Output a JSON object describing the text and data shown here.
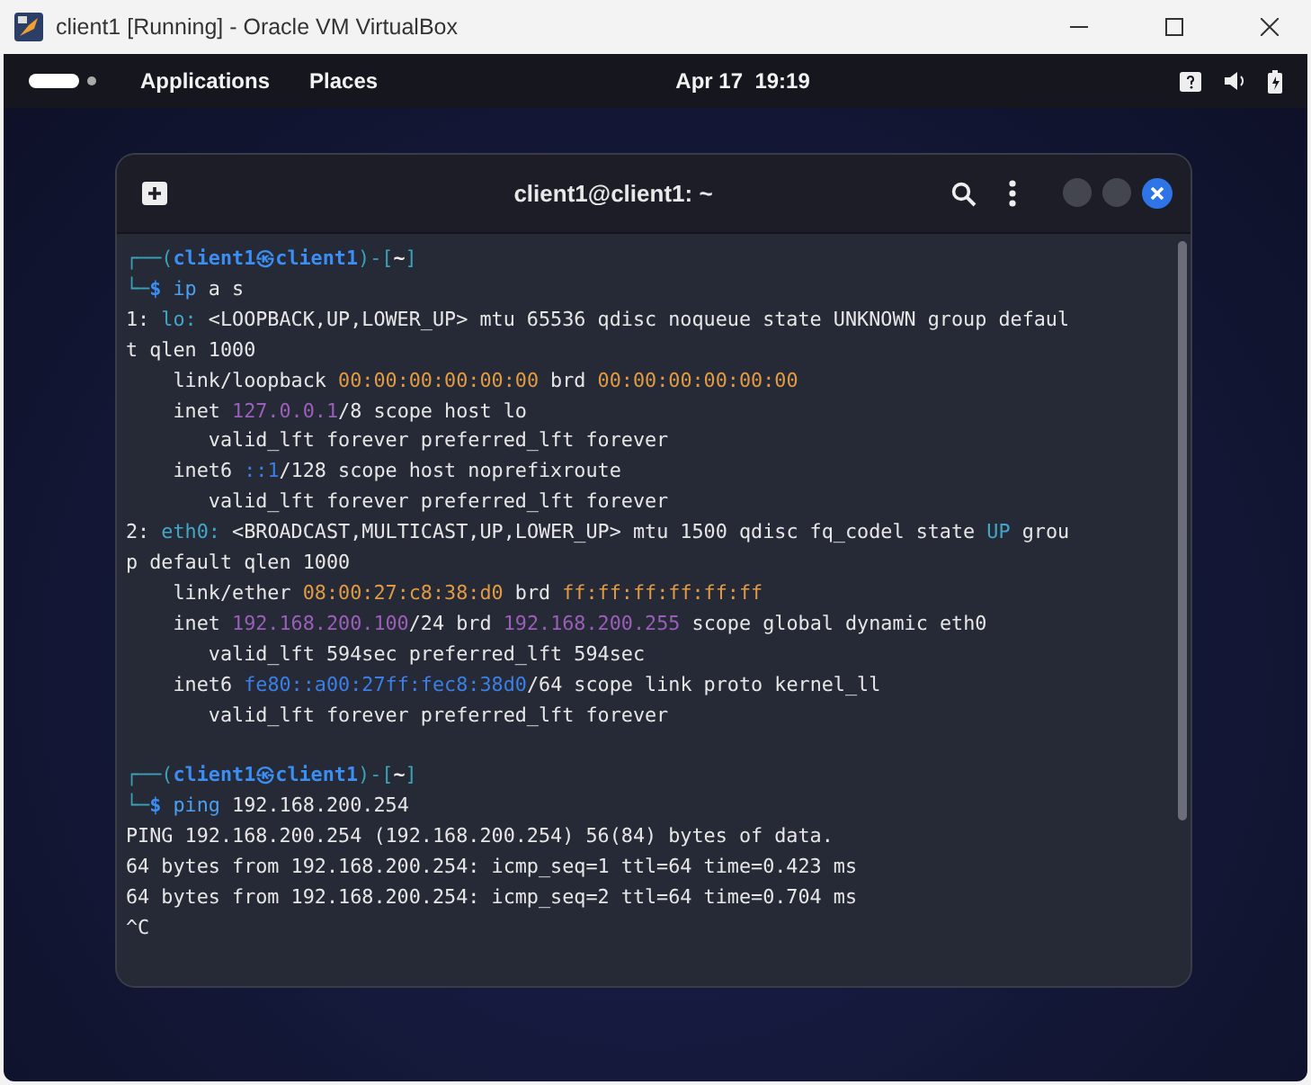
{
  "host_window": {
    "title": "client1 [Running] - Oracle VM VirtualBox"
  },
  "top_bar": {
    "menus": [
      "Applications",
      "Places"
    ],
    "clock": "Apr 17  19:19"
  },
  "terminal": {
    "title": "client1@client1: ~",
    "lines": [
      {
        "segments": [
          {
            "text": "┌──(",
            "kind": "frame"
          },
          {
            "text": "client1㉿client1",
            "kind": "user"
          },
          {
            "text": ")-[",
            "kind": "frame"
          },
          {
            "text": "~",
            "kind": "path"
          },
          {
            "text": "]",
            "kind": "frame"
          }
        ]
      },
      {
        "segments": [
          {
            "text": "└─",
            "kind": "frame"
          },
          {
            "text": "$",
            "kind": "user"
          },
          {
            "text": " ip",
            "kind": "cmd"
          },
          {
            "text": " a s",
            "kind": "text"
          }
        ]
      },
      {
        "segments": [
          {
            "text": "1: ",
            "kind": "text"
          },
          {
            "text": "lo:",
            "kind": "iface"
          },
          {
            "text": " <LOOPBACK,UP,LOWER_UP> mtu 65536 qdisc noqueue state UNKNOWN group defaul",
            "kind": "text"
          }
        ]
      },
      {
        "segments": [
          {
            "text": "t qlen 1000",
            "kind": "text"
          }
        ]
      },
      {
        "segments": [
          {
            "text": "    link/loopback ",
            "kind": "text"
          },
          {
            "text": "00:00:00:00:00:00",
            "kind": "mac"
          },
          {
            "text": " brd ",
            "kind": "text"
          },
          {
            "text": "00:00:00:00:00:00",
            "kind": "mac"
          }
        ]
      },
      {
        "segments": [
          {
            "text": "    inet ",
            "kind": "text"
          },
          {
            "text": "127.0.0.1",
            "kind": "ipv4"
          },
          {
            "text": "/8 scope host lo",
            "kind": "text"
          }
        ]
      },
      {
        "segments": [
          {
            "text": "       valid_lft forever preferred_lft forever",
            "kind": "text"
          }
        ]
      },
      {
        "segments": [
          {
            "text": "    inet6 ",
            "kind": "text"
          },
          {
            "text": "::1",
            "kind": "ipv6"
          },
          {
            "text": "/128 scope host noprefixroute",
            "kind": "text"
          }
        ]
      },
      {
        "segments": [
          {
            "text": "       valid_lft forever preferred_lft forever",
            "kind": "text"
          }
        ]
      },
      {
        "segments": [
          {
            "text": "2: ",
            "kind": "text"
          },
          {
            "text": "eth0:",
            "kind": "iface"
          },
          {
            "text": " <BROADCAST,MULTICAST,UP,LOWER_UP> mtu 1500 qdisc fq_codel state ",
            "kind": "text"
          },
          {
            "text": "UP",
            "kind": "iface"
          },
          {
            "text": " grou",
            "kind": "text"
          }
        ]
      },
      {
        "segments": [
          {
            "text": "p default qlen 1000",
            "kind": "text"
          }
        ]
      },
      {
        "segments": [
          {
            "text": "    link/ether ",
            "kind": "text"
          },
          {
            "text": "08:00:27:c8:38:d0",
            "kind": "mac"
          },
          {
            "text": " brd ",
            "kind": "text"
          },
          {
            "text": "ff:ff:ff:ff:ff:ff",
            "kind": "mac"
          }
        ]
      },
      {
        "segments": [
          {
            "text": "    inet ",
            "kind": "text"
          },
          {
            "text": "192.168.200.100",
            "kind": "ipv4"
          },
          {
            "text": "/24 brd ",
            "kind": "text"
          },
          {
            "text": "192.168.200.255",
            "kind": "ipv4"
          },
          {
            "text": " scope global dynamic eth0",
            "kind": "text"
          }
        ]
      },
      {
        "segments": [
          {
            "text": "       valid_lft 594sec preferred_lft 594sec",
            "kind": "text"
          }
        ]
      },
      {
        "segments": [
          {
            "text": "    inet6 ",
            "kind": "text"
          },
          {
            "text": "fe80::a00:27ff:fec8:38d0",
            "kind": "ipv6"
          },
          {
            "text": "/64 scope link proto kernel_ll",
            "kind": "text"
          }
        ]
      },
      {
        "segments": [
          {
            "text": "       valid_lft forever preferred_lft forever",
            "kind": "text"
          }
        ]
      },
      {
        "gap_before": true,
        "segments": [
          {
            "text": "┌──(",
            "kind": "frame"
          },
          {
            "text": "client1㉿client1",
            "kind": "user"
          },
          {
            "text": ")-[",
            "kind": "frame"
          },
          {
            "text": "~",
            "kind": "path"
          },
          {
            "text": "]",
            "kind": "frame"
          }
        ]
      },
      {
        "segments": [
          {
            "text": "└─",
            "kind": "frame"
          },
          {
            "text": "$",
            "kind": "user"
          },
          {
            "text": " ping",
            "kind": "cmd"
          },
          {
            "text": " 192.168.200.254",
            "kind": "text"
          }
        ]
      },
      {
        "segments": [
          {
            "text": "PING 192.168.200.254 (192.168.200.254) 56(84) bytes of data.",
            "kind": "text"
          }
        ]
      },
      {
        "segments": [
          {
            "text": "64 bytes from 192.168.200.254: icmp_seq=1 ttl=64 time=0.423 ms",
            "kind": "text"
          }
        ]
      },
      {
        "segments": [
          {
            "text": "64 bytes from 192.168.200.254: icmp_seq=2 ttl=64 time=0.704 ms",
            "kind": "text"
          }
        ]
      },
      {
        "segments": [
          {
            "text": "^C",
            "kind": "text"
          }
        ]
      }
    ]
  }
}
